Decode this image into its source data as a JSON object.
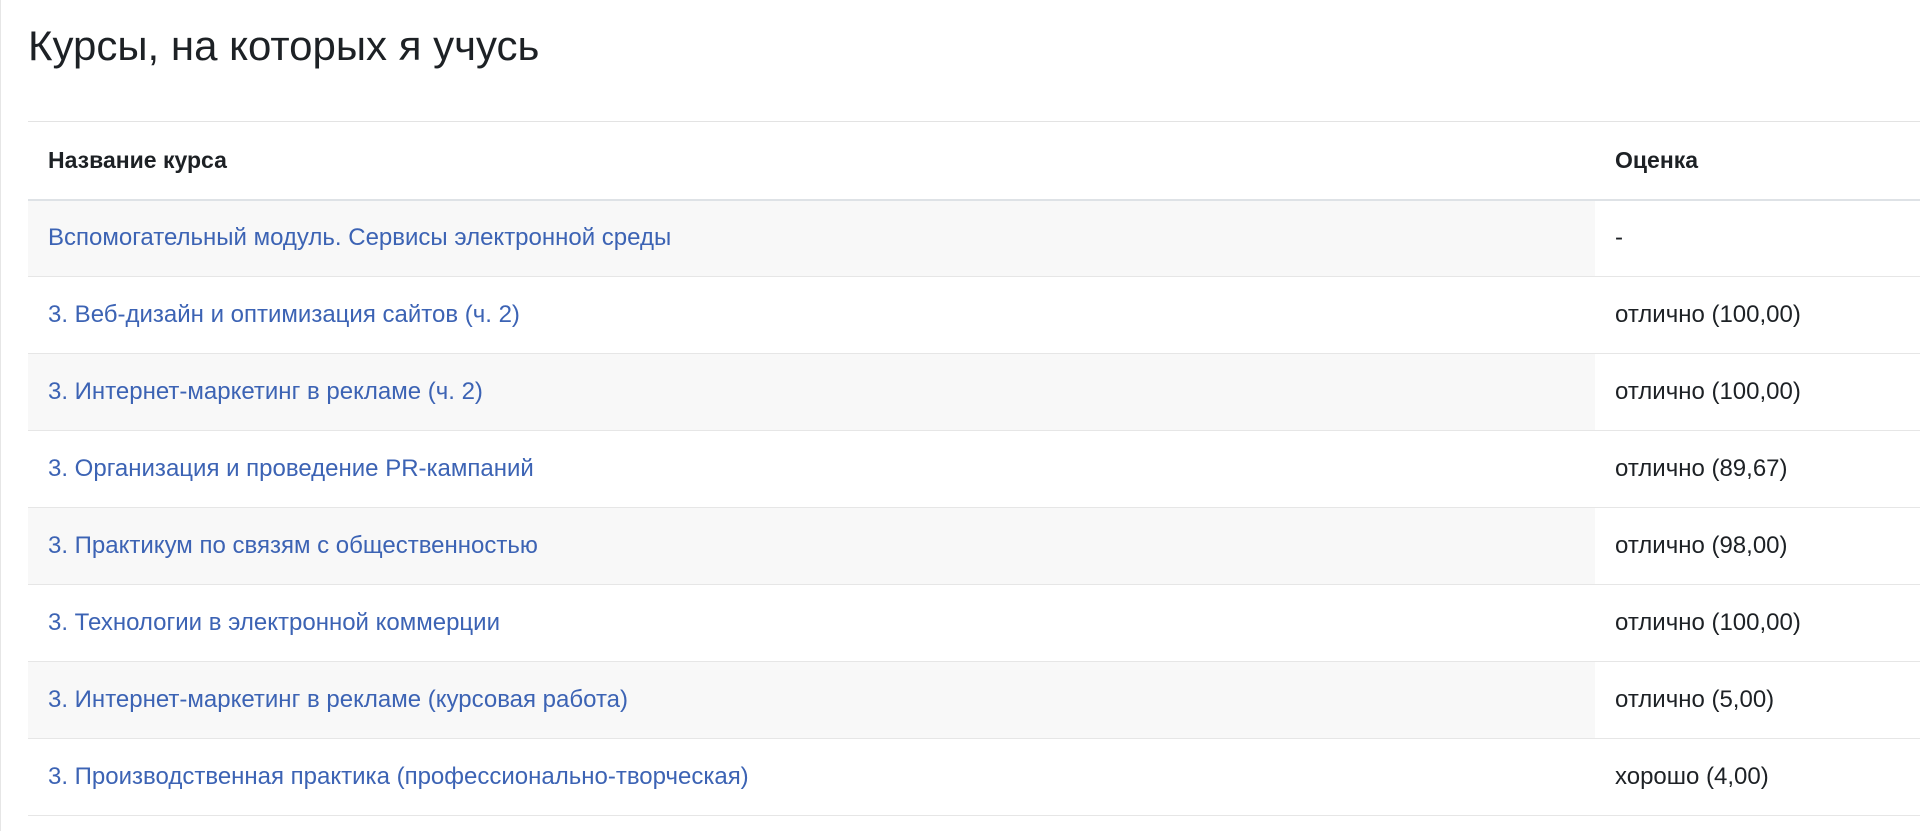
{
  "page": {
    "title": "Курсы, на которых я учусь"
  },
  "table": {
    "headers": {
      "course_name": "Название курса",
      "grade": "Оценка"
    },
    "rows": [
      {
        "course": "Вспомогательный модуль. Сервисы электронной среды",
        "grade": "-"
      },
      {
        "course": "3. Веб-дизайн и оптимизация сайтов (ч. 2)",
        "grade": "отлично (100,00)"
      },
      {
        "course": "3. Интернет-маркетинг в рекламе (ч. 2)",
        "grade": "отлично (100,00)"
      },
      {
        "course": "3. Организация и проведение PR-кампаний",
        "grade": "отлично (89,67)"
      },
      {
        "course": "3. Практикум по связям с общественностью",
        "grade": "отлично (98,00)"
      },
      {
        "course": "3. Технологии в электронной коммерции",
        "grade": "отлично (100,00)"
      },
      {
        "course": "3. Интернет-маркетинг в рекламе (курсовая работа)",
        "grade": "отлично (5,00)"
      },
      {
        "course": "3. Производственная практика (профессионально-творческая)",
        "grade": "хорошо (4,00)"
      }
    ]
  },
  "colors": {
    "link": "#3c63b4",
    "text": "#1d2125",
    "stripe": "#f8f8f8"
  }
}
